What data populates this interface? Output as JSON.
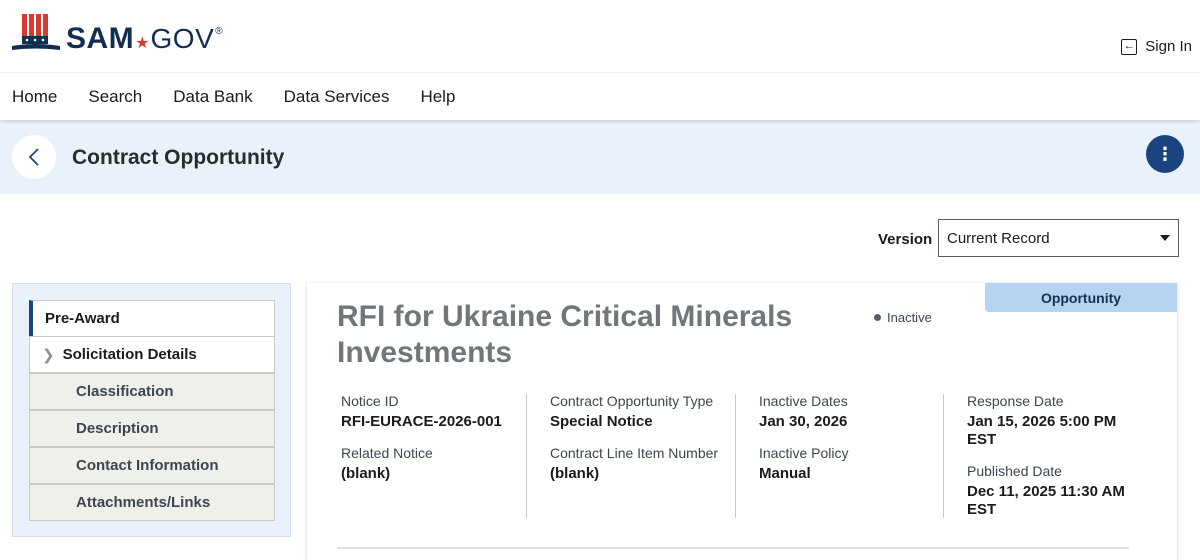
{
  "header": {
    "logo": {
      "sam": "SAM",
      "gov": "GOV",
      "reg": "®"
    },
    "signin_label": "Sign In"
  },
  "nav": {
    "items": [
      "Home",
      "Search",
      "Data Bank",
      "Data Services",
      "Help"
    ]
  },
  "titlebar": {
    "title": "Contract Opportunity"
  },
  "version": {
    "label": "Version",
    "selected": "Current Record"
  },
  "sidebar": {
    "primary": "Pre-Award",
    "section": "Solicitation Details",
    "items": [
      "Classification",
      "Description",
      "Contact Information",
      "Attachments/Links"
    ]
  },
  "opportunity": {
    "tag": "Opportunity",
    "title": "RFI for Ukraine Critical Minerals Investments",
    "status": "Inactive",
    "fields": {
      "notice_id": {
        "label": "Notice ID",
        "value": "RFI-EURACE-2026-001"
      },
      "related_notice": {
        "label": "Related Notice",
        "value": "(blank)"
      },
      "type": {
        "label": "Contract Opportunity Type",
        "value": "Special Notice"
      },
      "clin": {
        "label": "Contract Line Item Number",
        "value": "(blank)"
      },
      "inactive_dates": {
        "label": "Inactive Dates",
        "value": "Jan 30, 2026"
      },
      "inactive_policy": {
        "label": "Inactive Policy",
        "value": "Manual"
      },
      "response_date": {
        "label": "Response Date",
        "value": "Jan 15, 2026 5:00 PM",
        "value_tz": "EST"
      },
      "published_date": {
        "label": "Published Date",
        "value": "Dec 11, 2025 11:30 AM",
        "value_tz": "EST"
      }
    }
  },
  "colors": {
    "brand_navy": "#112e51",
    "brand_red": "#d83933",
    "titlebar_bg": "#e9f1fa",
    "accent_blue": "#1a4480",
    "tag_bg": "#b7d3f2"
  }
}
